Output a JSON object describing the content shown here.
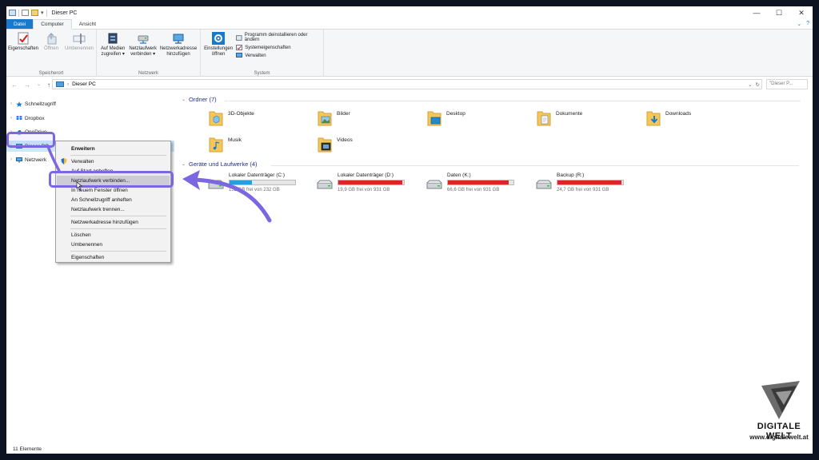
{
  "window": {
    "title": "Dieser PC",
    "buttons": {
      "minimize": "—",
      "maximize": "☐",
      "close": "✕"
    }
  },
  "ribbon": {
    "tabs": [
      "Datei",
      "Computer",
      "Ansicht"
    ],
    "groups": {
      "speicherort": {
        "label": "Speicherort",
        "buttons": [
          "Eigenschaften",
          "Öffnen",
          "Umbenennen"
        ]
      },
      "netzwerk": {
        "label": "Netzwerk",
        "buttons": [
          {
            "l1": "Auf Medien",
            "l2": "zugreifen ▾"
          },
          {
            "l1": "Netzlaufwerk",
            "l2": "verbinden ▾"
          },
          {
            "l1": "Netzwerkadresse",
            "l2": "hinzufügen"
          }
        ]
      },
      "system": {
        "label": "System",
        "settings": {
          "l1": "Einstellungen",
          "l2": "öffnen"
        },
        "items": [
          "Programm deinstallieren oder ändern",
          "Systemeigenschaften",
          "Verwalten"
        ]
      }
    }
  },
  "address": {
    "path": "Dieser PC",
    "search_placeholder": "\"Dieser P..."
  },
  "navpane": {
    "items": [
      "Schnellzugriff",
      "Dropbox",
      "OneDrive",
      "Dieser PC",
      "Netzwerk"
    ]
  },
  "content": {
    "folders_header": "Ordner (7)",
    "folders": [
      "3D-Objekte",
      "Bilder",
      "Desktop",
      "Dokumente",
      "Downloads",
      "Musik",
      "Videos"
    ],
    "drives_header": "Geräte und Laufwerke (4)",
    "drives": [
      {
        "name": "Lokaler Datenträger (C:)",
        "free": "152 GB frei von 232 GB",
        "used_fraction": 0.34,
        "color": "#26a0da"
      },
      {
        "name": "Lokaler Datenträger (D:)",
        "free": "19,9 GB frei von 931 GB",
        "used_fraction": 0.98,
        "color": "#da2626"
      },
      {
        "name": "Daten (K:)",
        "free": "66,6 GB frei von 931 GB",
        "used_fraction": 0.93,
        "color": "#da2626"
      },
      {
        "name": "Backup (R:)",
        "free": "24,7 GB frei von 931 GB",
        "used_fraction": 0.97,
        "color": "#da2626"
      }
    ]
  },
  "context_menu": {
    "items": [
      "Erweitern",
      "Verwalten",
      "Auf Start anheften",
      "Netzlaufwerk verbinden...",
      "In neuem Fenster öffnen",
      "An Schnellzugriff anheften",
      "Netzlaufwerk trennen...",
      "Netzwerkadresse hinzufügen",
      "Löschen",
      "Umbenennen",
      "Eigenschaften"
    ]
  },
  "status": {
    "count": "11 Elemente"
  },
  "logo": {
    "brand": "DIGITALE WELT",
    "url": "www.digitalewelt.at"
  },
  "colors": {
    "accent": "#1979ca",
    "highlight": "#7d67e0",
    "selection": "#cce8ff"
  }
}
